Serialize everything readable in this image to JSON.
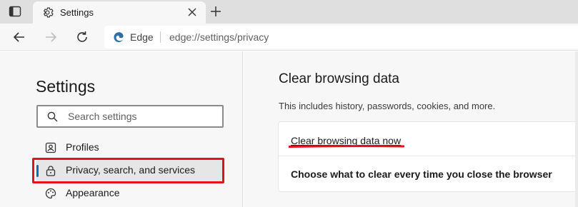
{
  "tab": {
    "title": "Settings"
  },
  "omnibox": {
    "site_label": "Edge",
    "url": "edge://settings/privacy"
  },
  "sidebar": {
    "title": "Settings",
    "search_placeholder": "Search settings",
    "items": [
      {
        "label": "Profiles",
        "icon": "profile-card-icon",
        "selected": false
      },
      {
        "label": "Privacy, search, and services",
        "icon": "lock-icon",
        "selected": true
      },
      {
        "label": "Appearance",
        "icon": "palette-icon",
        "selected": false
      }
    ]
  },
  "main": {
    "title": "Clear browsing data",
    "description": "This includes history, passwords, cookies, and more.",
    "clear_now_label": "Clear browsing data now",
    "choose_label": "Choose what to clear every time you close the browser"
  },
  "colors": {
    "accent": "#0f6cbd",
    "annotation_red": "#e0121c",
    "tab_strip": "#dfdfdf",
    "page_bg": "#f7f7f7"
  }
}
